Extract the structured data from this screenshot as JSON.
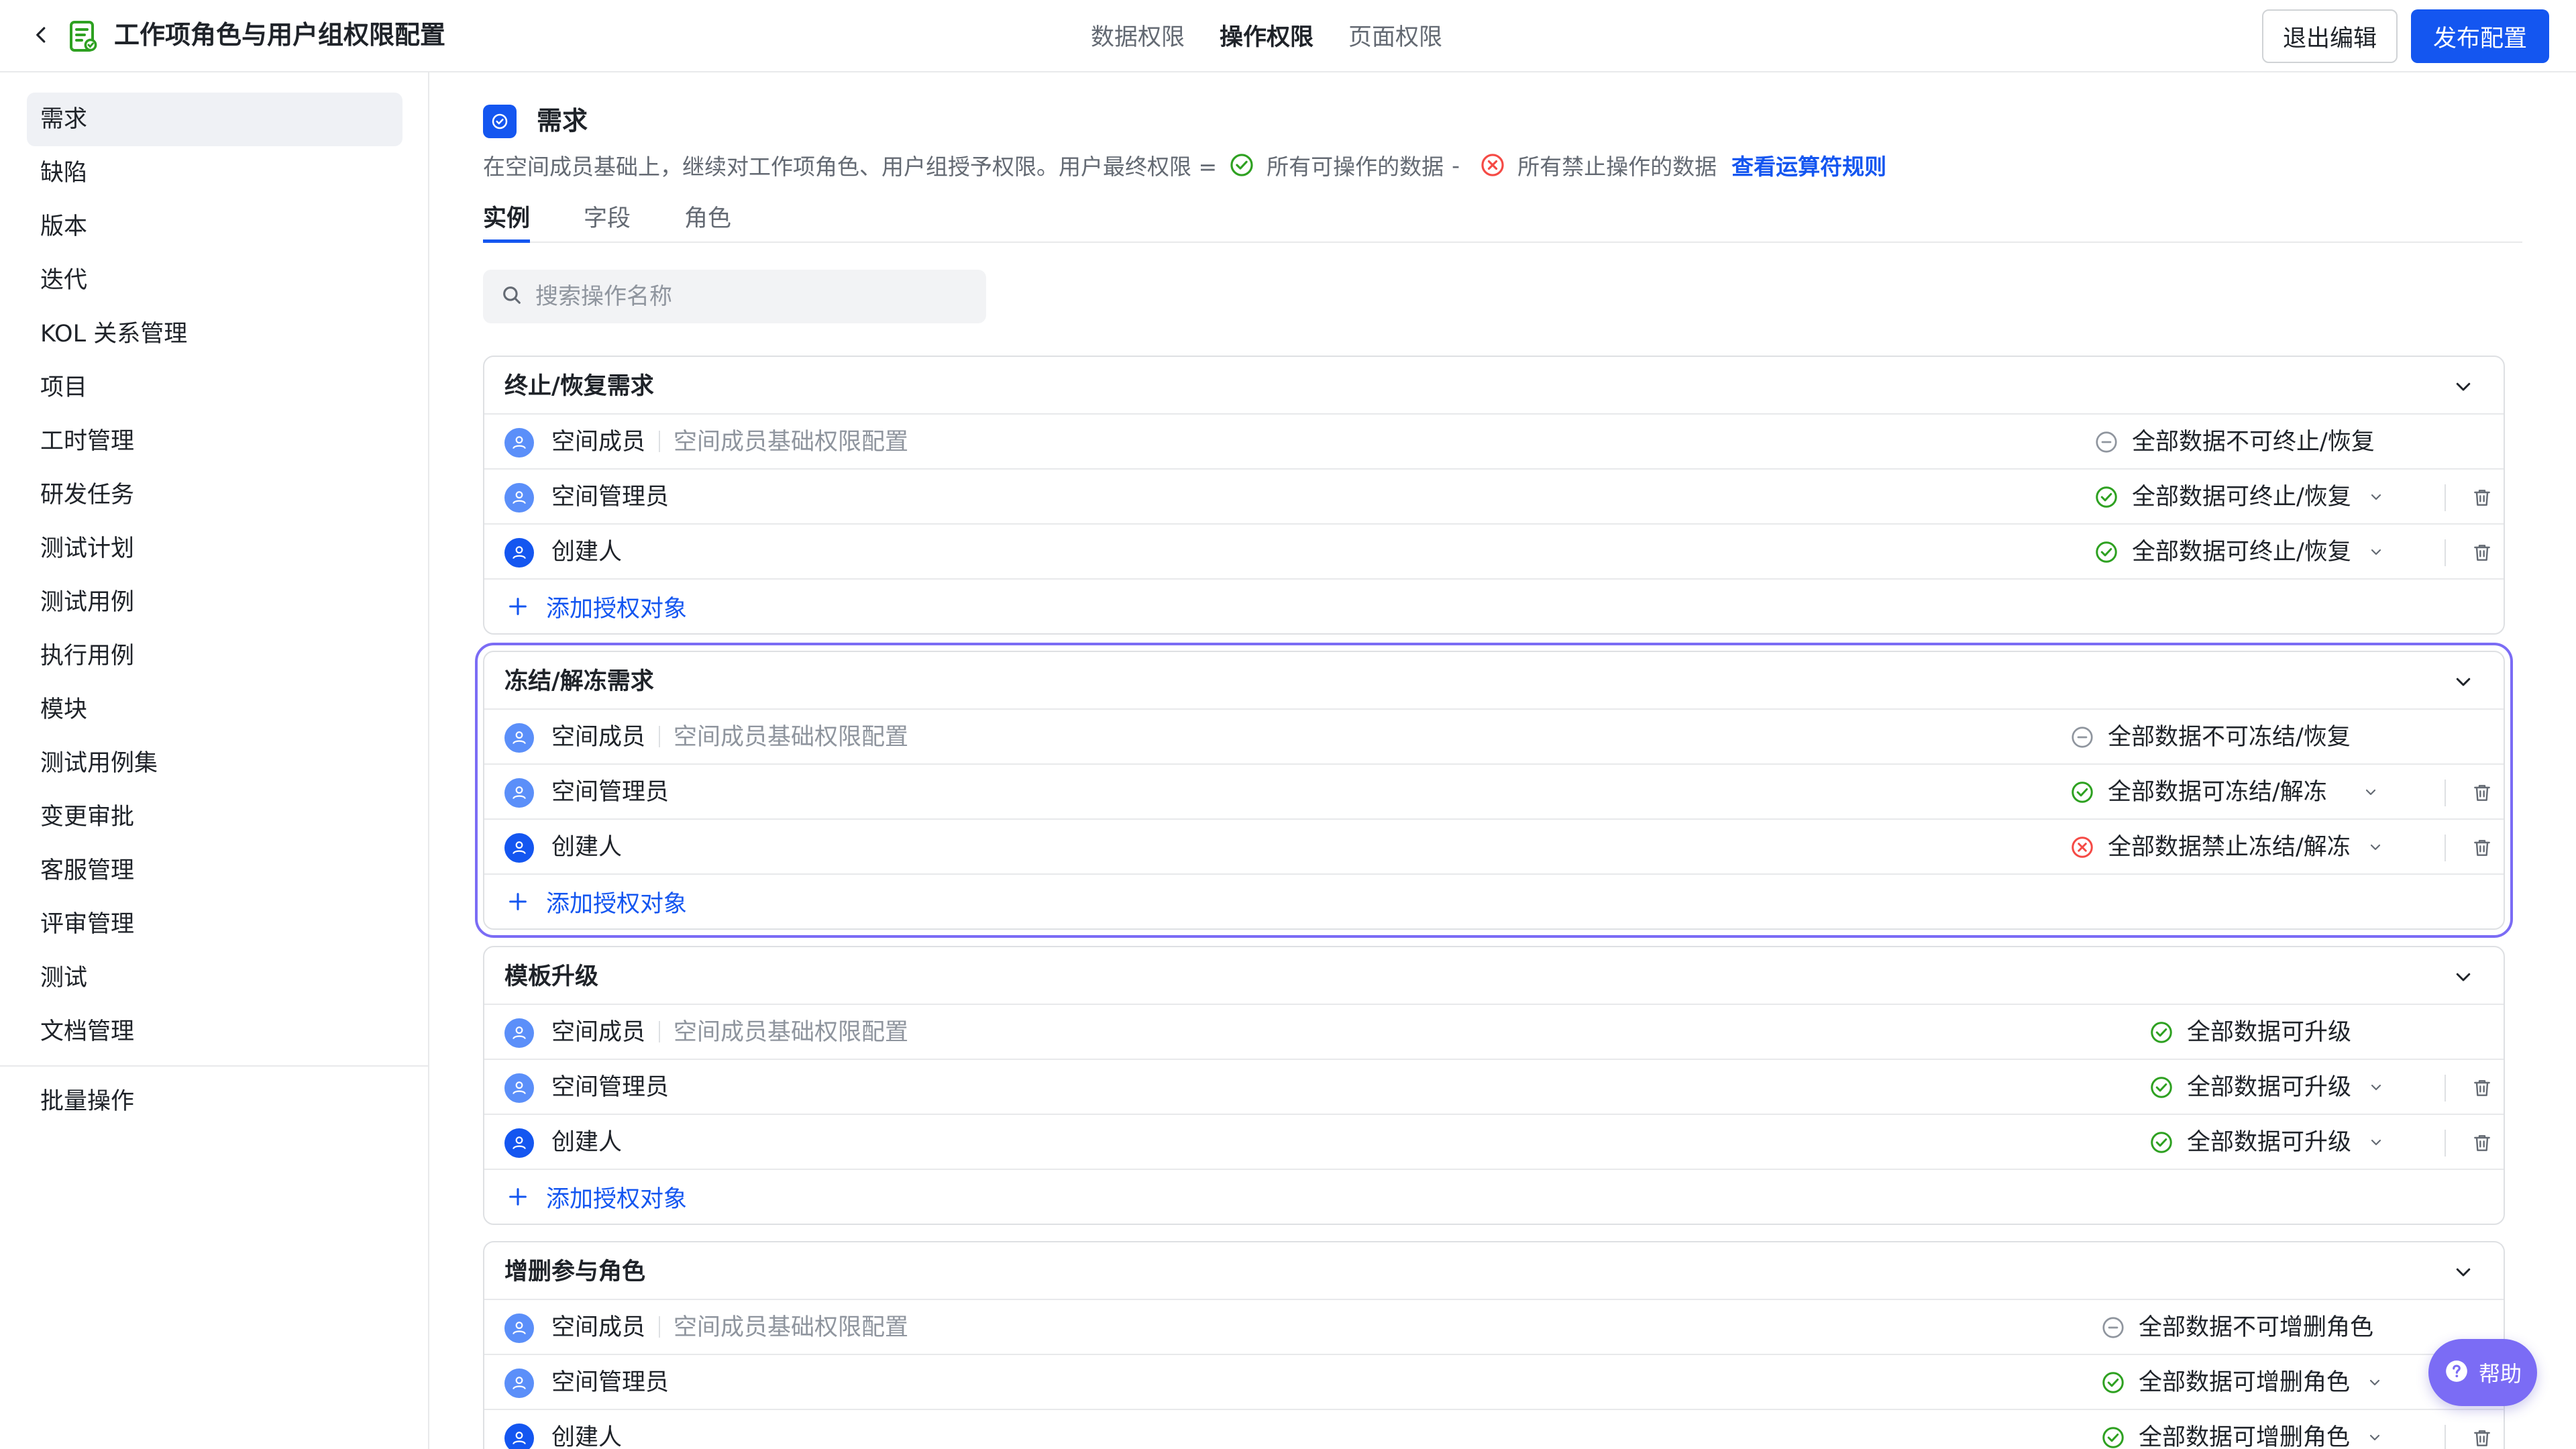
{
  "header": {
    "title": "工作项角色与用户组权限配置",
    "tabs": [
      {
        "label": "数据权限",
        "active": false
      },
      {
        "label": "操作权限",
        "active": true
      },
      {
        "label": "页面权限",
        "active": false
      }
    ],
    "exit_label": "退出编辑",
    "publish_label": "发布配置"
  },
  "sidebar": {
    "items": [
      {
        "label": "需求",
        "active": true
      },
      {
        "label": "缺陷"
      },
      {
        "label": "版本"
      },
      {
        "label": "迭代"
      },
      {
        "label": "KOL 关系管理"
      },
      {
        "label": "项目"
      },
      {
        "label": "工时管理"
      },
      {
        "label": "研发任务"
      },
      {
        "label": "测试计划"
      },
      {
        "label": "测试用例"
      },
      {
        "label": "执行用例"
      },
      {
        "label": "模块"
      },
      {
        "label": "测试用例集"
      },
      {
        "label": "变更审批"
      },
      {
        "label": "客服管理"
      },
      {
        "label": "评审管理"
      },
      {
        "label": "测试"
      },
      {
        "label": "文档管理"
      }
    ],
    "bottom_item": "批量操作"
  },
  "section": {
    "title": "需求",
    "desc_prefix": "在空间成员基础上，继续对工作项角色、用户组授予权限。用户最终权限 =",
    "desc_allow": "所有可操作的数据",
    "desc_minus": "-",
    "desc_deny": "所有禁止操作的数据",
    "desc_link": "查看运算符规则"
  },
  "sub_tabs": [
    {
      "label": "实例",
      "active": true
    },
    {
      "label": "字段"
    },
    {
      "label": "角色"
    }
  ],
  "search": {
    "placeholder": "搜索操作名称"
  },
  "cards": [
    {
      "title": "终止/恢复需求",
      "selected": false,
      "rows": [
        {
          "role": "空间成员",
          "note": "空间成员基础权限配置",
          "perm": "全部数据不可终止/恢复",
          "status": "neutral"
        },
        {
          "role": "空间管理员",
          "perm": "全部数据可终止/恢复",
          "status": "allow"
        },
        {
          "role": "创建人",
          "perm": "全部数据可终止/恢复",
          "status": "allow"
        }
      ],
      "add_label": "添加授权对象"
    },
    {
      "title": "冻结/解冻需求",
      "selected": true,
      "rows": [
        {
          "role": "空间成员",
          "note": "空间成员基础权限配置",
          "perm": "全部数据不可冻结/恢复",
          "status": "neutral"
        },
        {
          "role": "空间管理员",
          "perm": "全部数据可冻结/解冻",
          "status": "allow"
        },
        {
          "role": "创建人",
          "perm": "全部数据禁止冻结/解冻",
          "status": "deny"
        }
      ],
      "add_label": "添加授权对象"
    },
    {
      "title": "模板升级",
      "selected": false,
      "rows": [
        {
          "role": "空间成员",
          "note": "空间成员基础权限配置",
          "perm": "全部数据可升级",
          "status": "allow"
        },
        {
          "role": "空间管理员",
          "perm": "全部数据可升级",
          "status": "allow"
        },
        {
          "role": "创建人",
          "perm": "全部数据可升级",
          "status": "allow"
        }
      ],
      "add_label": "添加授权对象"
    },
    {
      "title": "增删参与角色",
      "selected": false,
      "rows": [
        {
          "role": "空间成员",
          "note": "空间成员基础权限配置",
          "perm": "全部数据不可增删角色",
          "status": "neutral"
        },
        {
          "role": "空间管理员",
          "perm": "全部数据可增删角色",
          "status": "allow"
        },
        {
          "role": "创建人",
          "perm": "全部数据可增删角色",
          "status": "allow"
        }
      ]
    }
  ],
  "help": {
    "label": "帮助"
  },
  "colors": {
    "accent": "#1456f0",
    "allow": "#2ea121",
    "deny": "#f54a45",
    "neutral": "#8f959e",
    "selection": "#7b6cf5"
  }
}
